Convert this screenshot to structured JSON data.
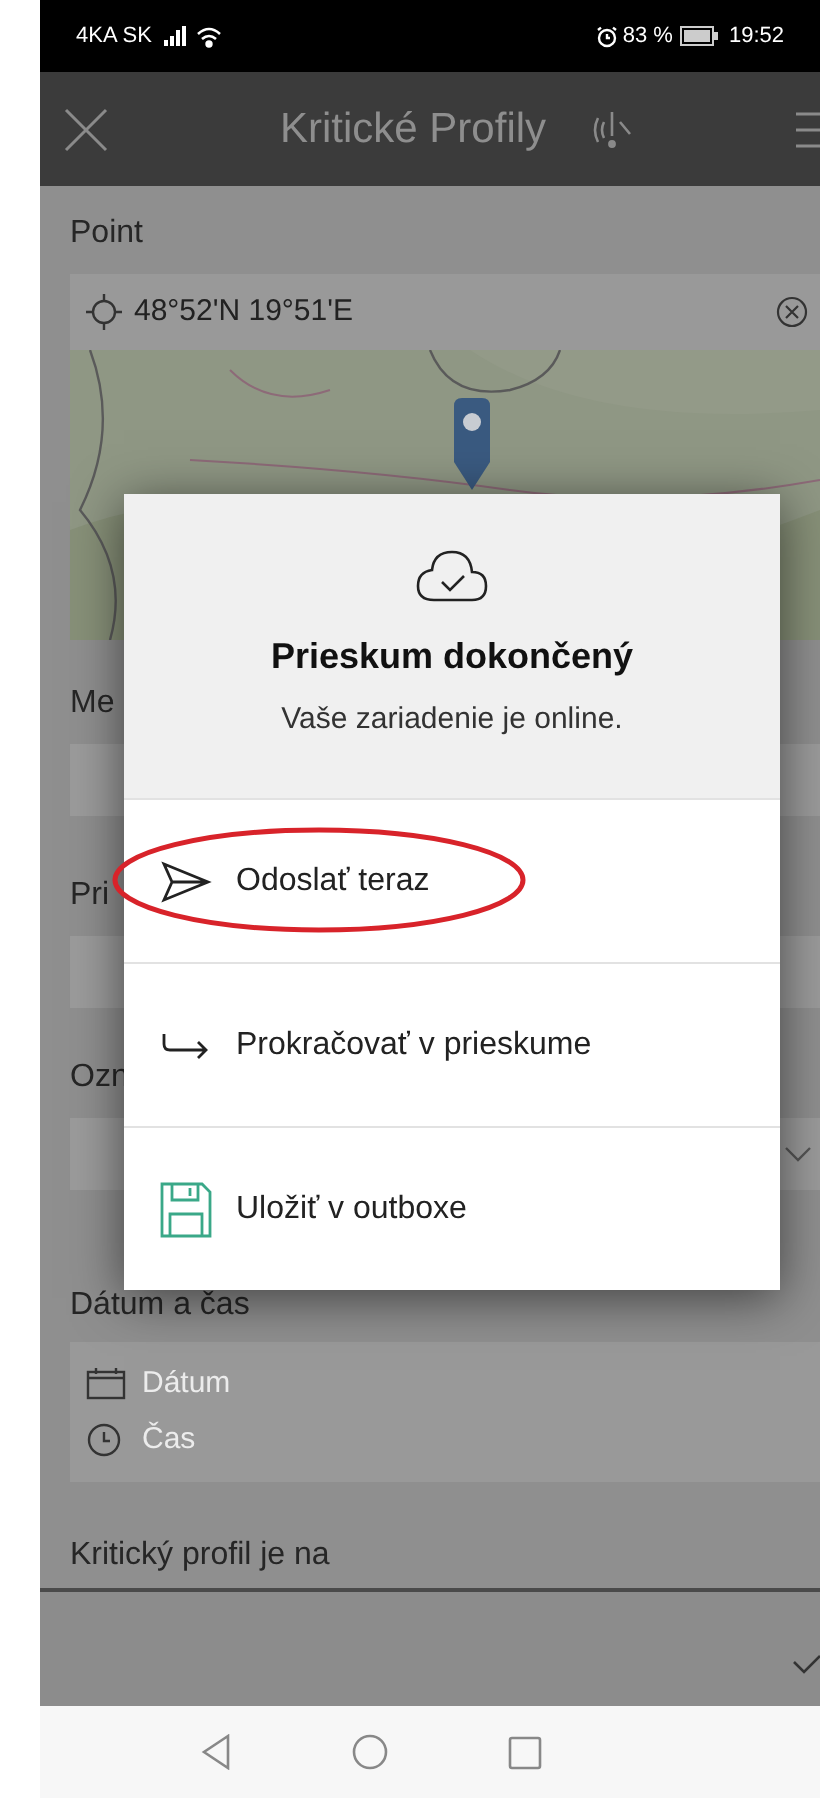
{
  "status_bar": {
    "carrier": "4KA SK",
    "battery": "83 %",
    "time": "19:52"
  },
  "header": {
    "title": "Kritické Profily"
  },
  "form": {
    "point": {
      "label": "Point",
      "coordinates": "48°52'N 19°51'E"
    },
    "fields": [
      {
        "kind": "text",
        "label": "Me"
      },
      {
        "kind": "text",
        "label": "Pri"
      },
      {
        "kind": "dropdown",
        "label": "Ozn"
      }
    ],
    "datetime": {
      "label": "Dátum a čas",
      "date_placeholder": "Dátum",
      "time_placeholder": "Čas"
    },
    "last_label": "Kritický profil je na"
  },
  "dialog": {
    "title": "Prieskum dokončený",
    "subtitle": "Vaše zariadenie je online.",
    "actions": [
      {
        "kind": "send",
        "label": "Odoslať teraz",
        "highlighted": true
      },
      {
        "kind": "continue",
        "label": "Prokračovať v prieskume",
        "highlighted": false
      },
      {
        "kind": "save",
        "label": "Uložiť v outboxe",
        "highlighted": false
      }
    ]
  }
}
